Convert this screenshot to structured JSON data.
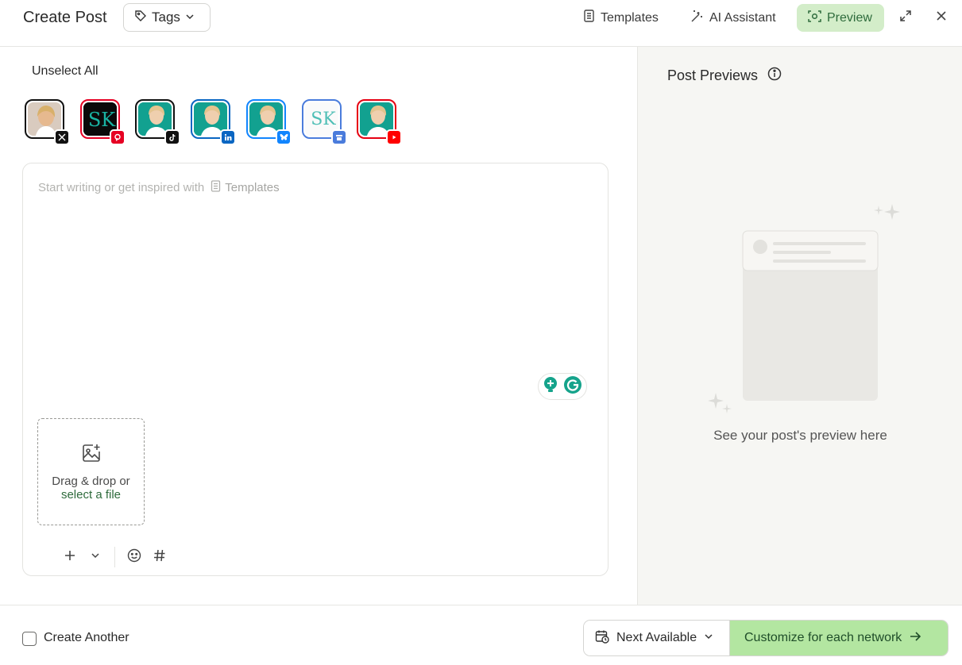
{
  "header": {
    "title": "Create Post",
    "tags_label": "Tags",
    "templates_label": "Templates",
    "ai_assistant_label": "AI Assistant",
    "preview_label": "Preview"
  },
  "left": {
    "unselect_all": "Unselect All",
    "accounts": [
      {
        "network": "X",
        "icon": "x-icon",
        "color": "#111111"
      },
      {
        "network": "Pinterest",
        "icon": "pinterest-icon",
        "color": "#e60023"
      },
      {
        "network": "TikTok",
        "icon": "tiktok-icon",
        "color": "#111111"
      },
      {
        "network": "LinkedIn",
        "icon": "linkedin-icon",
        "color": "#0a66c2"
      },
      {
        "network": "Bluesky",
        "icon": "bluesky-icon",
        "color": "#1185fe"
      },
      {
        "network": "Google Business",
        "icon": "google-business-icon",
        "color": "#4a7cdc"
      },
      {
        "network": "YouTube",
        "icon": "youtube-icon",
        "color": "#ff0000"
      }
    ],
    "editor": {
      "placeholder": "Start writing or get inspired with",
      "placeholder_link": "Templates"
    },
    "dropzone": {
      "line1": "Drag & drop or",
      "line2": "select a file"
    }
  },
  "right": {
    "title": "Post Previews",
    "caption": "See your post's preview here"
  },
  "footer": {
    "create_another": "Create Another",
    "next_available": "Next Available",
    "customize": "Customize for each network"
  },
  "colors": {
    "accent_green": "#2e6b3c",
    "preview_bg": "#d3edc9",
    "customize_bg": "#b3e6a1",
    "panel_bg": "#f6f6f3"
  }
}
